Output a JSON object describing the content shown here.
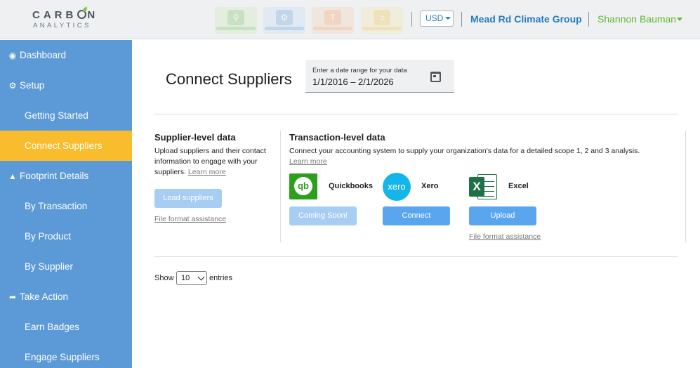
{
  "header": {
    "logo_top": "CARB",
    "logo_top_end": "N",
    "logo_bottom": "ANALYTICS",
    "currency": "USD",
    "organization": "Mead Rd Climate Group",
    "user": "Shannon Bauman"
  },
  "badges": [
    {
      "icon": "search-icon",
      "color": "#9bd08a"
    },
    {
      "icon": "gear-icon",
      "color": "#8fb8e0"
    },
    {
      "icon": "text-icon",
      "color": "#f2b58a"
    },
    {
      "icon": "megaphone-icon",
      "color": "#f2d27a"
    }
  ],
  "sidebar": {
    "items": [
      {
        "label": "Dashboard",
        "icon": "dashboard-icon"
      },
      {
        "label": "Setup",
        "icon": "gear-icon"
      },
      {
        "label": "Getting Started"
      },
      {
        "label": "Connect Suppliers"
      },
      {
        "label": "Footprint Details",
        "icon": "tree-icon"
      },
      {
        "label": "By Transaction"
      },
      {
        "label": "By Product"
      },
      {
        "label": "By Supplier"
      },
      {
        "label": "Take Action",
        "icon": "share-icon"
      },
      {
        "label": "Earn Badges"
      },
      {
        "label": "Engage Suppliers"
      }
    ],
    "active_color": "#f9bc2c",
    "background": "#5b9ad7"
  },
  "main": {
    "title": "Connect Suppliers",
    "date_range": {
      "label": "Enter a date range for your data",
      "value": "1/1/2016 – 2/1/2026"
    },
    "supplier_level": {
      "title": "Supplier-level data",
      "description": "Upload suppliers and their contact information to engage with your suppliers.",
      "learn_more": "Learn more",
      "button": "Load suppliers",
      "file_format_link": "File format assistance"
    },
    "transaction_level": {
      "title": "Transaction-level data",
      "description": "Connect your accounting system to supply your organization's data for a detailed scope 1, 2 and 3 analysis.",
      "learn_more": "Learn more",
      "providers": [
        {
          "name": "Quickbooks",
          "button": "Coming Soon!",
          "logo": "qb"
        },
        {
          "name": "Xero",
          "button": "Connect",
          "logo": "xero"
        },
        {
          "name": "Excel",
          "button": "Upload",
          "logo": "X",
          "file_format_link": "File format assistance"
        }
      ]
    },
    "table": {
      "show_label": "Show",
      "entries_value": "10",
      "entries_label": "entries"
    }
  }
}
